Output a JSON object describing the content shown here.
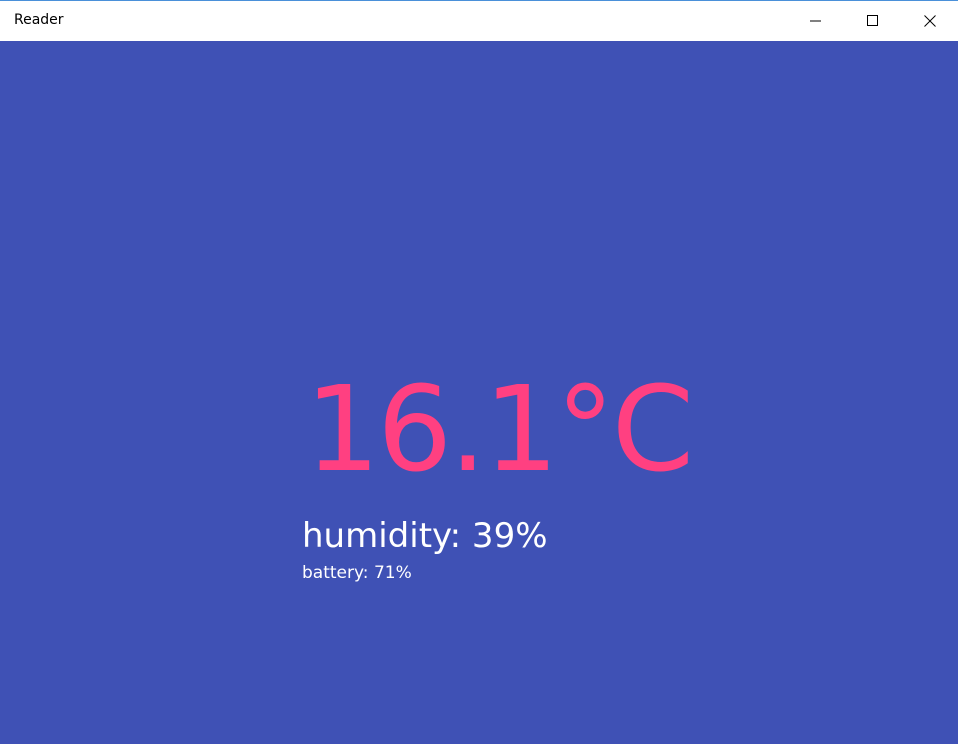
{
  "window": {
    "title": "Reader",
    "controls": {
      "minimize": "minimize-icon",
      "maximize": "maximize-icon",
      "close": "close-icon"
    }
  },
  "reading": {
    "temperature": "16.1°C",
    "humidity": "humidity: 39%",
    "battery": "battery: 71%"
  },
  "colors": {
    "background": "#3f51b5",
    "temperature": "#ff4081",
    "text": "#ffffff",
    "titlebar": "#ffffff"
  }
}
